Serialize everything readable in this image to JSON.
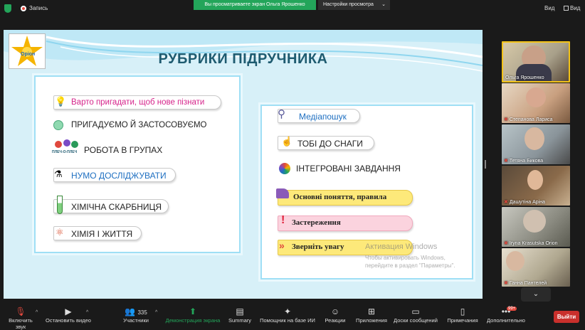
{
  "topbar": {
    "recording_label": "Запись",
    "share_banner": "Вы просматриваете экран Ольга Ярошенко",
    "view_settings": "Настройки просмотра",
    "view_left": "Вид",
    "view_right": "Вид"
  },
  "slide": {
    "logo_text": "Оріон",
    "title": "РУБРИКИ ПІДРУЧНИКА",
    "left_items": [
      "Варто пригадати, щоб нове пізнати",
      "ПРИГАДУЄМО Й ЗАСТОСОВУЄМО",
      "РОБОТА В ГРУПАХ",
      "НУМО ДОСЛІДЖУВАТИ",
      "ХІМІЧНА СКАРБНИЦЯ",
      "ХІМІЯ І ЖИТТЯ"
    ],
    "right_items": [
      "Медіапошук",
      "ТОБІ ДО СНАГИ",
      "ІНТЕГРОВАНІ ЗАВДАННЯ",
      "Основні поняття, правила",
      "Застереження",
      "Зверніть увагу"
    ],
    "group_icon_text": "ПЛЕЧ-О-ПЛЕЧ",
    "watermark_title": "Активация Windows",
    "watermark_line1": "Чтобы активировать Windows,",
    "watermark_line2": "перейдите в раздел \"Параметры\"."
  },
  "participants": [
    {
      "name": "Ольга Ярошенко",
      "active": true
    },
    {
      "name": "Степанова Лариса",
      "active": false
    },
    {
      "name": "Тетяна Бикова",
      "active": false
    },
    {
      "name": "Дашутіна Аріна",
      "active": false
    },
    {
      "name": "Iryna Krasutska Orion",
      "active": false
    },
    {
      "name": "Ганна Пантелей",
      "active": false
    }
  ],
  "toolbar": {
    "unmute": "Включить звук",
    "video": "Остановить видео",
    "participants": "Участники",
    "participants_count": "335",
    "share": "Демонстрация экрана",
    "summary": "Summary",
    "ai": "Помощник на базе ИИ",
    "reactions": "Реакции",
    "apps": "Приложения",
    "boards": "Доски сообщений",
    "notes": "Примечания",
    "more": "Дополнительно",
    "more_badge": "99+",
    "leave": "Выйти"
  },
  "colors": {
    "accent_green": "#23a55a",
    "leave_red": "#c9302c",
    "active_speaker": "#f2c218",
    "slide_title": "#1e5b70"
  }
}
